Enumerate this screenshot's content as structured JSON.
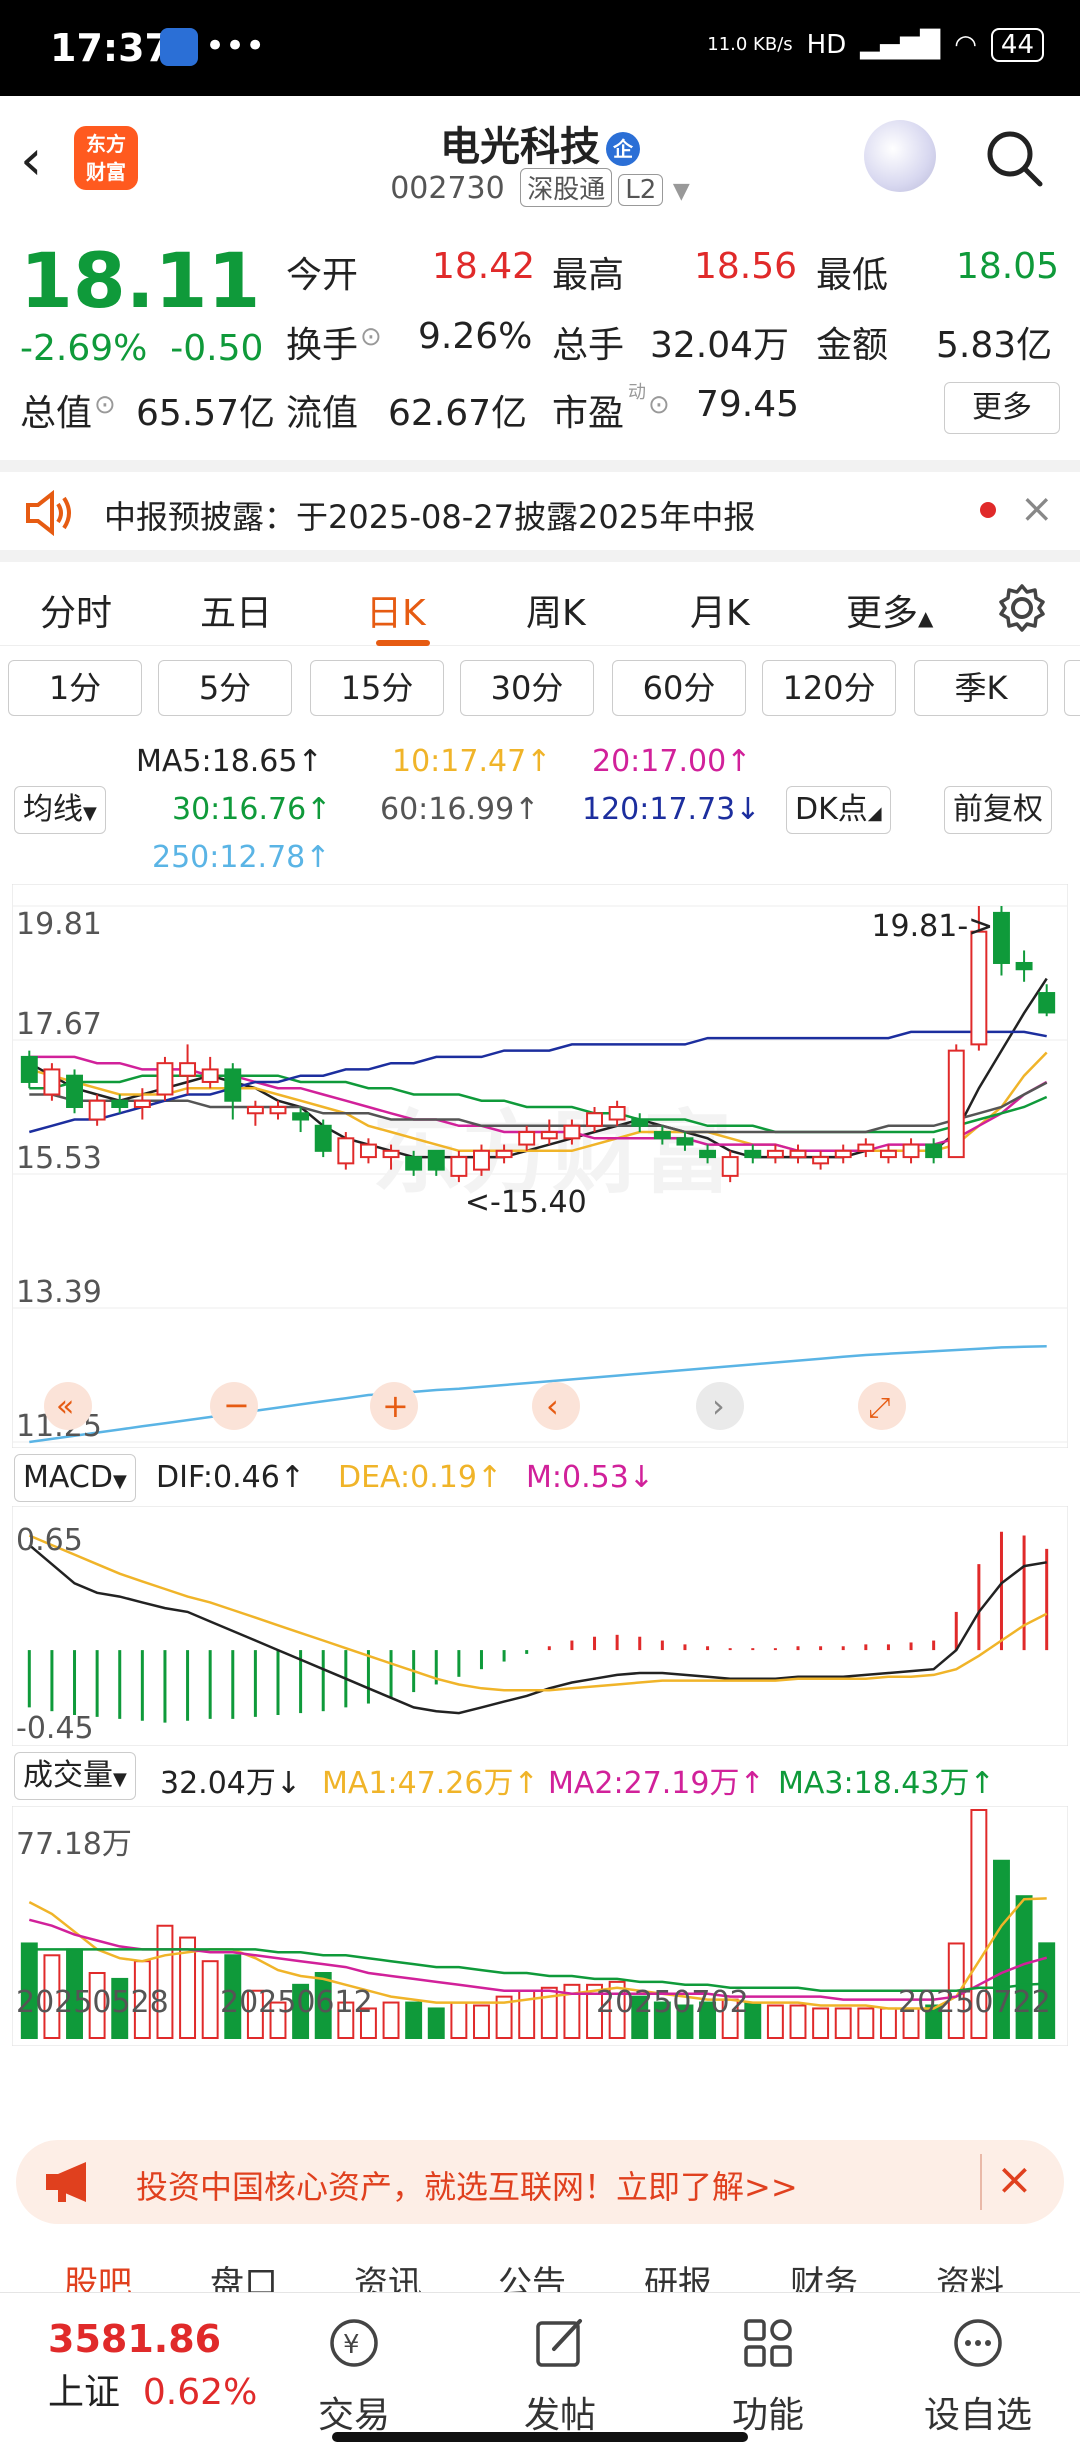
{
  "status": {
    "time": "17:37",
    "dots": "•••",
    "net_speed": "11.0 KB/s",
    "signal": "HD",
    "battery": "44"
  },
  "header": {
    "logo_text_1": "东方",
    "logo_text_2": "财富",
    "stock_name": "电光科技",
    "ent_badge": "企",
    "code": "002730",
    "tag_sgt": "深股通",
    "tag_l2": "L2"
  },
  "quote": {
    "price": "18.11",
    "change_pct": "-2.69%",
    "change": "-0.50",
    "open_label": "今开",
    "open": "18.42",
    "high_label": "最高",
    "high": "18.56",
    "low_label": "最低",
    "low": "18.05",
    "turnover_label": "换手",
    "turnover": "9.26%",
    "vol_label": "总手",
    "vol": "32.04万",
    "amount_label": "金额",
    "amount": "5.83亿",
    "mcap_label": "总值",
    "mcap": "65.57亿",
    "float_label": "流值",
    "float": "62.67亿",
    "pe_label": "市盈",
    "pe_sup": "动",
    "pe": "79.45",
    "more_label": "更多"
  },
  "notice": {
    "text": "中报预披露：于2025-08-27披露2025年中报"
  },
  "tabs": [
    "分时",
    "五日",
    "日K",
    "周K",
    "月K",
    "更多"
  ],
  "minute_buttons": [
    "1分",
    "5分",
    "15分",
    "30分",
    "60分",
    "120分",
    "季K"
  ],
  "ma": {
    "selector": "均线",
    "ma5": "MA5:18.65↑",
    "ma10": "10:17.47↑",
    "ma20": "20:17.00↑",
    "ma30": "30:16.76↑",
    "ma60": "60:16.99↑",
    "ma120": "120:17.73↓",
    "ma250": "250:12.78↑",
    "dk": "DK点",
    "fq": "前复权",
    "colors": {
      "ma5": "#222222",
      "ma10": "#f0b429",
      "ma20": "#d1219a",
      "ma30": "#0f9a3a",
      "ma60": "#555555",
      "ma120": "#1c2e9e",
      "ma250": "#5ab4e5"
    }
  },
  "kchart": {
    "y_labels": [
      "19.81",
      "17.67",
      "15.53",
      "13.39",
      "11.25"
    ],
    "high_note": "19.81->",
    "low_note": "<-15.40",
    "watermark": "东方财富"
  },
  "macd": {
    "selector": "MACD",
    "dif": "DIF:0.46↑",
    "dea": "DEA:0.19↑",
    "m": "M:0.53↓",
    "y_top": "0.65",
    "y_bottom": "-0.45"
  },
  "volume": {
    "selector": "成交量",
    "vol": "32.04万↓",
    "ma1": "MA1:47.26万↑",
    "ma2": "MA2:27.19万↑",
    "ma3": "MA3:18.43万↑",
    "y_top": "77.18万"
  },
  "dates": [
    "20250528",
    "20250612",
    "20250702",
    "20250722"
  ],
  "ad": {
    "text": "投资中国核心资产，就选互联网！立即了解>>"
  },
  "subtabs": [
    "股吧",
    "盘口",
    "资讯",
    "公告",
    "研报",
    "财务",
    "资料"
  ],
  "bottom": {
    "index_value": "3581.86",
    "index_name": "上证",
    "index_chg": "0.62%",
    "items": [
      "交易",
      "发帖",
      "功能",
      "设自选"
    ]
  },
  "chart_data": {
    "type": "candlestick",
    "title": "电光科技 日K",
    "ylim": [
      11.25,
      19.81
    ],
    "y_ticks": [
      19.81,
      17.67,
      15.53,
      13.39,
      11.25
    ],
    "x_ticks": [
      "20250528",
      "20250612",
      "20250702",
      "20250722"
    ],
    "candles": [
      {
        "o": 17.4,
        "c": 17.0,
        "h": 17.5,
        "l": 16.9
      },
      {
        "o": 16.8,
        "c": 17.2,
        "h": 17.3,
        "l": 16.7
      },
      {
        "o": 17.1,
        "c": 16.6,
        "h": 17.2,
        "l": 16.5
      },
      {
        "o": 16.4,
        "c": 16.7,
        "h": 16.8,
        "l": 16.3
      },
      {
        "o": 16.7,
        "c": 16.6,
        "h": 16.8,
        "l": 16.5
      },
      {
        "o": 16.6,
        "c": 16.7,
        "h": 16.9,
        "l": 16.4
      },
      {
        "o": 16.8,
        "c": 17.3,
        "h": 17.4,
        "l": 16.7
      },
      {
        "o": 17.1,
        "c": 17.3,
        "h": 17.6,
        "l": 16.8
      },
      {
        "o": 17.0,
        "c": 17.2,
        "h": 17.4,
        "l": 16.9
      },
      {
        "o": 17.2,
        "c": 16.7,
        "h": 17.3,
        "l": 16.4
      },
      {
        "o": 16.5,
        "c": 16.6,
        "h": 16.7,
        "l": 16.3
      },
      {
        "o": 16.5,
        "c": 16.6,
        "h": 16.7,
        "l": 16.4
      },
      {
        "o": 16.5,
        "c": 16.4,
        "h": 16.6,
        "l": 16.2
      },
      {
        "o": 16.3,
        "c": 15.9,
        "h": 16.4,
        "l": 15.8
      },
      {
        "o": 15.7,
        "c": 16.1,
        "h": 16.2,
        "l": 15.6
      },
      {
        "o": 15.8,
        "c": 16.0,
        "h": 16.1,
        "l": 15.7
      },
      {
        "o": 15.8,
        "c": 15.9,
        "h": 16.0,
        "l": 15.6
      },
      {
        "o": 15.8,
        "c": 15.6,
        "h": 15.9,
        "l": 15.5
      },
      {
        "o": 15.9,
        "c": 15.6,
        "h": 15.9,
        "l": 15.5
      },
      {
        "o": 15.5,
        "c": 15.8,
        "h": 15.9,
        "l": 15.4
      },
      {
        "o": 15.6,
        "c": 15.9,
        "h": 16.0,
        "l": 15.5
      },
      {
        "o": 15.8,
        "c": 15.9,
        "h": 16.0,
        "l": 15.7
      },
      {
        "o": 16.0,
        "c": 16.2,
        "h": 16.3,
        "l": 15.9
      },
      {
        "o": 16.1,
        "c": 16.2,
        "h": 16.4,
        "l": 16.0
      },
      {
        "o": 16.1,
        "c": 16.3,
        "h": 16.4,
        "l": 16.0
      },
      {
        "o": 16.3,
        "c": 16.5,
        "h": 16.6,
        "l": 16.2
      },
      {
        "o": 16.4,
        "c": 16.6,
        "h": 16.7,
        "l": 16.3
      },
      {
        "o": 16.4,
        "c": 16.3,
        "h": 16.5,
        "l": 16.2
      },
      {
        "o": 16.2,
        "c": 16.1,
        "h": 16.3,
        "l": 16.0
      },
      {
        "o": 16.1,
        "c": 16.0,
        "h": 16.2,
        "l": 15.9
      },
      {
        "o": 15.9,
        "c": 15.8,
        "h": 16.0,
        "l": 15.7
      },
      {
        "o": 15.5,
        "c": 15.8,
        "h": 15.9,
        "l": 15.4
      },
      {
        "o": 15.9,
        "c": 15.8,
        "h": 16.0,
        "l": 15.7
      },
      {
        "o": 15.8,
        "c": 15.9,
        "h": 16.0,
        "l": 15.7
      },
      {
        "o": 15.8,
        "c": 15.9,
        "h": 16.0,
        "l": 15.7
      },
      {
        "o": 15.7,
        "c": 15.8,
        "h": 15.9,
        "l": 15.6
      },
      {
        "o": 15.8,
        "c": 15.9,
        "h": 16.0,
        "l": 15.7
      },
      {
        "o": 15.9,
        "c": 16.0,
        "h": 16.1,
        "l": 15.8
      },
      {
        "o": 15.8,
        "c": 15.9,
        "h": 16.0,
        "l": 15.7
      },
      {
        "o": 15.8,
        "c": 16.0,
        "h": 16.1,
        "l": 15.7
      },
      {
        "o": 16.0,
        "c": 15.8,
        "h": 16.1,
        "l": 15.7
      },
      {
        "o": 15.8,
        "c": 17.5,
        "h": 17.6,
        "l": 15.8
      },
      {
        "o": 17.6,
        "c": 19.4,
        "h": 19.81,
        "l": 17.5
      },
      {
        "o": 19.7,
        "c": 18.9,
        "h": 19.81,
        "l": 18.7
      },
      {
        "o": 18.9,
        "c": 18.8,
        "h": 19.1,
        "l": 18.6
      },
      {
        "o": 18.42,
        "c": 18.11,
        "h": 18.56,
        "l": 18.05
      }
    ],
    "ma_series": {
      "ma5": [
        17.3,
        17.1,
        16.9,
        16.8,
        16.7,
        16.8,
        16.9,
        17.0,
        17.1,
        17.0,
        16.9,
        16.7,
        16.6,
        16.3,
        16.1,
        16.0,
        15.9,
        15.8,
        15.8,
        15.8,
        15.8,
        15.8,
        15.9,
        16.0,
        16.1,
        16.2,
        16.3,
        16.4,
        16.3,
        16.2,
        16.1,
        15.9,
        15.8,
        15.8,
        15.8,
        15.8,
        15.8,
        15.9,
        15.9,
        15.9,
        15.9,
        16.2,
        16.9,
        17.5,
        18.1,
        18.65
      ],
      "ma10": [
        17.2,
        17.1,
        17.0,
        16.9,
        16.8,
        16.8,
        16.8,
        16.9,
        16.9,
        16.9,
        16.9,
        16.8,
        16.7,
        16.6,
        16.5,
        16.3,
        16.2,
        16.1,
        16.0,
        15.9,
        15.9,
        15.9,
        15.9,
        15.9,
        15.9,
        16.0,
        16.1,
        16.2,
        16.2,
        16.2,
        16.2,
        16.1,
        16.0,
        16.0,
        15.9,
        15.9,
        15.9,
        15.9,
        15.9,
        15.9,
        15.9,
        16.0,
        16.3,
        16.6,
        17.1,
        17.47
      ],
      "ma20": [
        17.4,
        17.4,
        17.4,
        17.3,
        17.3,
        17.2,
        17.2,
        17.2,
        17.1,
        17.1,
        17.0,
        16.9,
        16.9,
        16.8,
        16.7,
        16.6,
        16.5,
        16.4,
        16.4,
        16.3,
        16.3,
        16.2,
        16.2,
        16.2,
        16.2,
        16.1,
        16.1,
        16.1,
        16.1,
        16.1,
        16.0,
        16.0,
        16.0,
        16.0,
        15.9,
        15.9,
        15.9,
        15.9,
        16.0,
        16.0,
        16.0,
        16.1,
        16.3,
        16.5,
        16.8,
        17.0
      ],
      "ma30": [
        16.9,
        16.9,
        17.0,
        17.0,
        17.0,
        17.1,
        17.1,
        17.1,
        17.1,
        17.1,
        17.1,
        17.1,
        17.0,
        17.0,
        17.0,
        16.9,
        16.9,
        16.8,
        16.8,
        16.8,
        16.7,
        16.7,
        16.6,
        16.6,
        16.6,
        16.5,
        16.5,
        16.4,
        16.4,
        16.4,
        16.3,
        16.3,
        16.3,
        16.2,
        16.2,
        16.2,
        16.2,
        16.2,
        16.2,
        16.2,
        16.2,
        16.3,
        16.4,
        16.5,
        16.6,
        16.76
      ],
      "ma60": [
        16.8,
        16.8,
        16.7,
        16.7,
        16.7,
        16.7,
        16.7,
        16.7,
        16.6,
        16.6,
        16.6,
        16.6,
        16.6,
        16.5,
        16.5,
        16.5,
        16.4,
        16.4,
        16.4,
        16.4,
        16.3,
        16.3,
        16.3,
        16.3,
        16.3,
        16.3,
        16.3,
        16.3,
        16.3,
        16.2,
        16.2,
        16.2,
        16.2,
        16.2,
        16.2,
        16.2,
        16.2,
        16.2,
        16.3,
        16.3,
        16.3,
        16.4,
        16.5,
        16.6,
        16.8,
        16.99
      ],
      "ma120": [
        16.2,
        16.3,
        16.4,
        16.4,
        16.5,
        16.6,
        16.7,
        16.8,
        16.8,
        16.9,
        17.0,
        17.0,
        17.1,
        17.1,
        17.2,
        17.2,
        17.3,
        17.3,
        17.4,
        17.4,
        17.4,
        17.5,
        17.5,
        17.5,
        17.6,
        17.6,
        17.6,
        17.6,
        17.6,
        17.6,
        17.7,
        17.7,
        17.7,
        17.7,
        17.7,
        17.7,
        17.7,
        17.7,
        17.7,
        17.8,
        17.8,
        17.8,
        17.8,
        17.8,
        17.8,
        17.73
      ],
      "ma250": [
        11.25,
        11.3,
        11.35,
        11.4,
        11.45,
        11.5,
        11.55,
        11.6,
        11.65,
        11.7,
        11.75,
        11.8,
        11.85,
        11.9,
        11.95,
        12.0,
        12.02,
        12.05,
        12.08,
        12.1,
        12.13,
        12.16,
        12.19,
        12.22,
        12.25,
        12.28,
        12.31,
        12.34,
        12.37,
        12.4,
        12.43,
        12.46,
        12.49,
        12.52,
        12.55,
        12.58,
        12.61,
        12.64,
        12.66,
        12.68,
        12.7,
        12.72,
        12.74,
        12.76,
        12.77,
        12.78
      ]
    },
    "macd_hist": [
      -0.3,
      -0.32,
      -0.34,
      -0.35,
      -0.36,
      -0.37,
      -0.38,
      -0.37,
      -0.36,
      -0.36,
      -0.35,
      -0.34,
      -0.33,
      -0.32,
      -0.3,
      -0.28,
      -0.25,
      -0.22,
      -0.18,
      -0.14,
      -0.1,
      -0.06,
      -0.02,
      0.02,
      0.05,
      0.07,
      0.08,
      0.07,
      0.05,
      0.03,
      0.02,
      0.01,
      0.01,
      0.01,
      0.02,
      0.02,
      0.02,
      0.03,
      0.03,
      0.04,
      0.05,
      0.2,
      0.45,
      0.62,
      0.6,
      0.53
    ],
    "macd_dif": [
      0.55,
      0.45,
      0.35,
      0.3,
      0.28,
      0.25,
      0.22,
      0.2,
      0.15,
      0.1,
      0.05,
      0.0,
      -0.05,
      -0.1,
      -0.15,
      -0.2,
      -0.25,
      -0.3,
      -0.32,
      -0.33,
      -0.3,
      -0.27,
      -0.24,
      -0.2,
      -0.17,
      -0.15,
      -0.13,
      -0.12,
      -0.12,
      -0.13,
      -0.14,
      -0.15,
      -0.15,
      -0.15,
      -0.14,
      -0.14,
      -0.14,
      -0.13,
      -0.12,
      -0.11,
      -0.1,
      0.0,
      0.2,
      0.35,
      0.44,
      0.46
    ],
    "macd_dea": [
      0.6,
      0.55,
      0.5,
      0.45,
      0.4,
      0.36,
      0.32,
      0.28,
      0.25,
      0.21,
      0.17,
      0.13,
      0.09,
      0.05,
      0.01,
      -0.03,
      -0.07,
      -0.11,
      -0.15,
      -0.18,
      -0.2,
      -0.21,
      -0.21,
      -0.21,
      -0.2,
      -0.19,
      -0.18,
      -0.17,
      -0.16,
      -0.16,
      -0.16,
      -0.16,
      -0.16,
      -0.16,
      -0.15,
      -0.15,
      -0.15,
      -0.15,
      -0.14,
      -0.14,
      -0.13,
      -0.1,
      -0.03,
      0.05,
      0.13,
      0.19
    ],
    "volume": [
      32,
      28,
      30,
      22,
      20,
      26,
      38,
      34,
      26,
      28,
      16,
      12,
      18,
      22,
      12,
      10,
      12,
      12,
      10,
      12,
      11,
      14,
      16,
      17,
      18,
      18,
      19,
      14,
      12,
      11,
      12,
      13,
      12,
      11,
      11,
      10,
      10,
      10,
      10,
      10,
      11,
      32,
      77.18,
      60,
      48,
      32.04
    ],
    "vol_ma1": [
      46,
      42,
      36,
      30,
      27,
      26,
      28,
      29,
      30,
      30,
      27,
      23,
      21,
      20,
      18,
      16,
      14,
      13,
      12,
      12,
      12,
      12,
      13,
      14,
      15,
      16,
      17,
      16,
      15,
      14,
      13,
      13,
      12,
      12,
      12,
      11,
      11,
      11,
      10,
      10,
      10,
      14,
      26,
      38,
      47,
      47.26
    ],
    "vol_ma2": [
      40,
      38,
      35,
      33,
      31,
      30,
      30,
      30,
      29,
      29,
      28,
      27,
      26,
      25,
      24,
      22,
      21,
      20,
      19,
      18,
      17,
      16,
      16,
      16,
      15,
      15,
      15,
      15,
      15,
      15,
      15,
      14,
      14,
      14,
      14,
      14,
      13,
      13,
      13,
      13,
      13,
      14,
      18,
      22,
      25,
      27.19
    ],
    "vol_ma3": [
      30,
      30,
      30,
      30,
      30,
      30,
      30,
      30,
      30,
      30,
      30,
      29,
      29,
      28,
      28,
      27,
      26,
      25,
      24,
      24,
      23,
      22,
      22,
      21,
      21,
      20,
      20,
      19,
      19,
      18,
      18,
      17,
      17,
      17,
      17,
      16,
      16,
      16,
      16,
      16,
      16,
      16,
      17,
      17,
      18,
      18.43
    ]
  }
}
